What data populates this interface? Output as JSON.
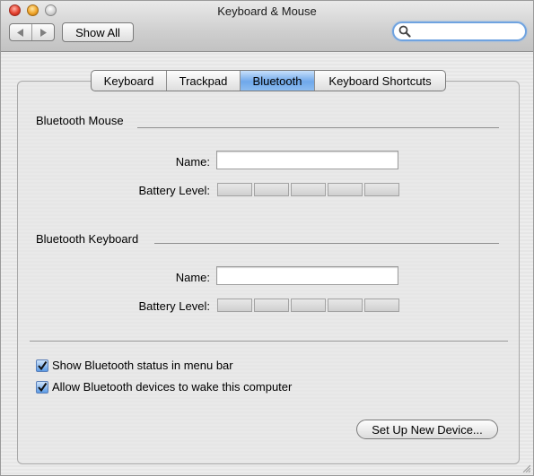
{
  "window": {
    "title": "Keyboard & Mouse"
  },
  "toolbar": {
    "show_all_label": "Show All",
    "search_placeholder": "",
    "search_value": ""
  },
  "tabs": [
    {
      "label": "Keyboard",
      "active": false
    },
    {
      "label": "Trackpad",
      "active": false
    },
    {
      "label": "Bluetooth",
      "active": true
    },
    {
      "label": "Keyboard Shortcuts",
      "active": false
    }
  ],
  "mouse_section": {
    "heading": "Bluetooth Mouse",
    "name_label": "Name:",
    "name_value": "",
    "battery_label": "Battery Level:",
    "battery_level": 0
  },
  "keyboard_section": {
    "heading": "Bluetooth Keyboard",
    "name_label": "Name:",
    "name_value": "",
    "battery_label": "Battery Level:",
    "battery_level": 0
  },
  "options": {
    "show_status": {
      "label": "Show Bluetooth status in menu bar",
      "checked": true
    },
    "allow_wake": {
      "label": "Allow Bluetooth devices to wake this computer",
      "checked": true
    }
  },
  "setup_button_label": "Set Up New Device...",
  "colors": {
    "accent": "#6fa8ea",
    "checkbox": "#5b9be6"
  }
}
